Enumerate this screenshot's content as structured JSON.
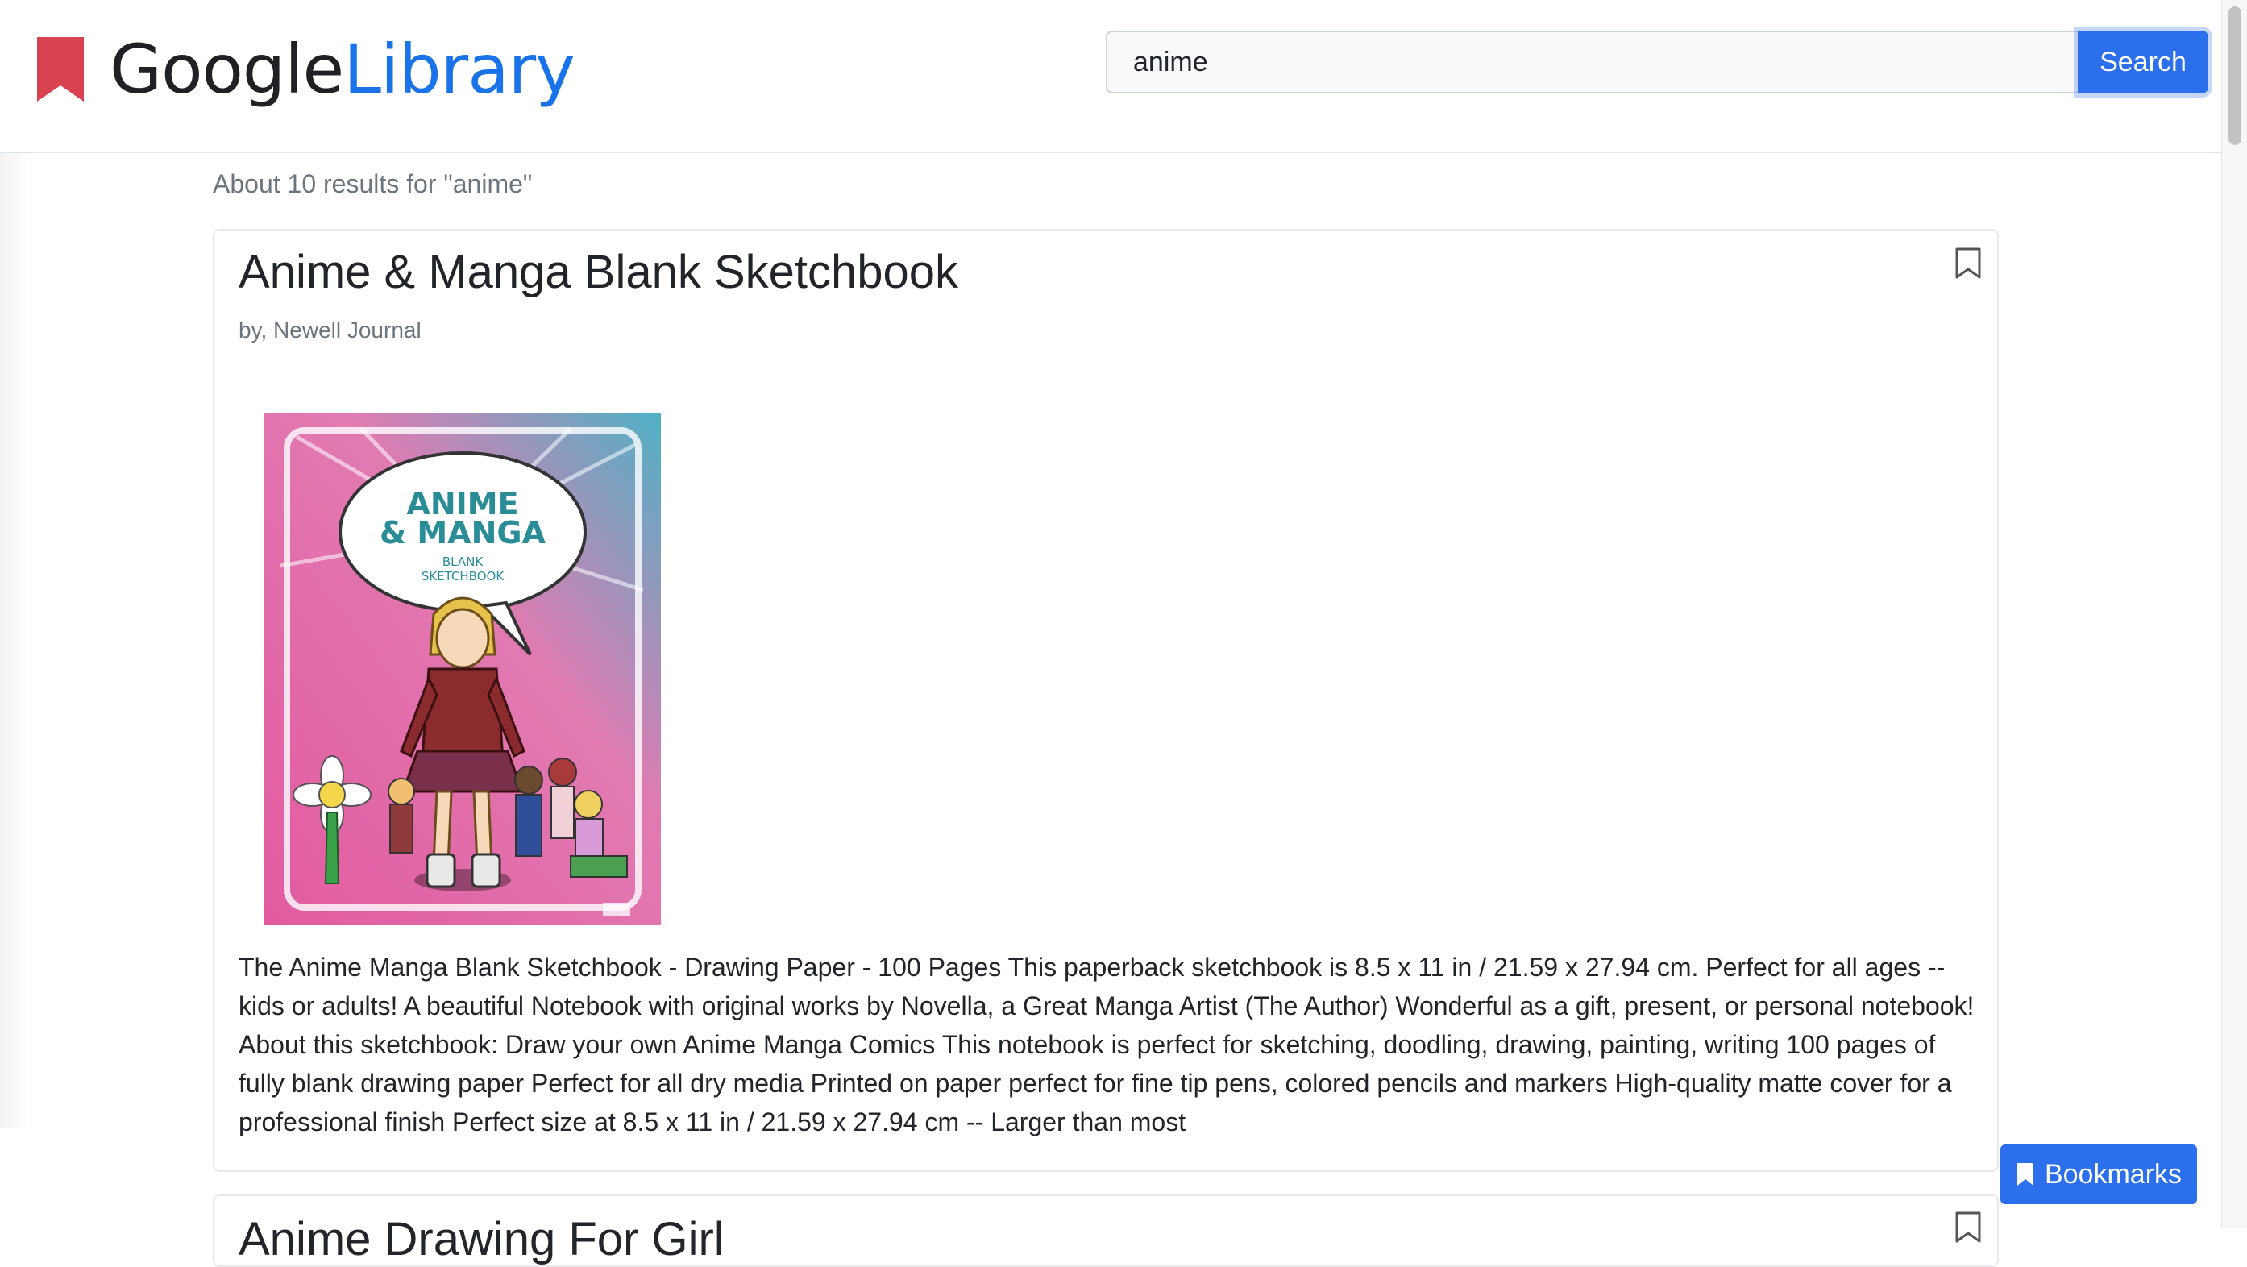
{
  "header": {
    "logo_google": "Google",
    "logo_library": "Library",
    "logo_icon": "bookmark-icon"
  },
  "search": {
    "value": "anime",
    "placeholder": "",
    "button_label": "Search"
  },
  "results": {
    "summary": "About 10 results for \"anime\"",
    "items": [
      {
        "title": "Anime & Manga Blank Sketchbook",
        "author": "by, Newell Journal",
        "cover": {
          "title_line1": "ANIME",
          "title_line2": "& MANGA",
          "subtitle_line1": "BLANK",
          "subtitle_line2": "SKETCHBOOK"
        },
        "description": "The Anime Manga Blank Sketchbook - Drawing Paper - 100 Pages This paperback sketchbook is 8.5 x 11 in / 21.59 x 27.94 cm. Perfect for all ages -- kids or adults! A beautiful Notebook with original works by Novella, a Great Manga Artist (The Author) Wonderful as a gift, present, or personal notebook! About this sketchbook: Draw your own Anime Manga Comics This notebook is perfect for sketching, doodling, drawing, painting, writing 100 pages of fully blank drawing paper Perfect for all dry media Printed on paper perfect for fine tip pens, colored pencils and markers High-quality matte cover for a professional finish Perfect size at 8.5 x 11 in / 21.59 x 27.94 cm -- Larger than most"
      },
      {
        "title": "Anime Drawing For Girl"
      }
    ]
  },
  "bookmarks_button": {
    "label": "Bookmarks",
    "icon": "bookmark-icon"
  },
  "colors": {
    "brand_red": "#d9434f",
    "brand_blue": "#1a73e8",
    "primary_button": "#2c6fed",
    "muted_text": "#6c757d"
  }
}
